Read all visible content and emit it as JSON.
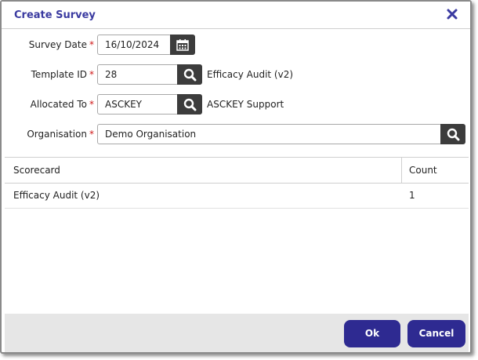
{
  "dialog": {
    "title": "Create Survey"
  },
  "form": {
    "survey_date": {
      "label": "Survey Date",
      "required_mark": "*",
      "value": "16/10/2024"
    },
    "template_id": {
      "label": "Template ID",
      "required_mark": "*",
      "value": "28",
      "description": "Efficacy Audit (v2)"
    },
    "allocated_to": {
      "label": "Allocated To",
      "required_mark": "*",
      "value": "ASCKEY",
      "description": "ASCKEY Support"
    },
    "organisation": {
      "label": "Organisation",
      "required_mark": "*",
      "value": "Demo Organisation"
    }
  },
  "grid": {
    "columns": [
      "Scorecard",
      "Count"
    ],
    "rows": [
      {
        "scorecard": "Efficacy Audit (v2)",
        "count": "1"
      }
    ]
  },
  "buttons": {
    "ok": "Ok",
    "cancel": "Cancel"
  },
  "colors": {
    "title": "#3a3aa0",
    "button": "#2e2a91",
    "icon_button": "#3c3c3c",
    "required": "#d01818"
  },
  "icons": {
    "close": "close-icon",
    "calendar": "calendar-icon",
    "search": "search-icon"
  }
}
